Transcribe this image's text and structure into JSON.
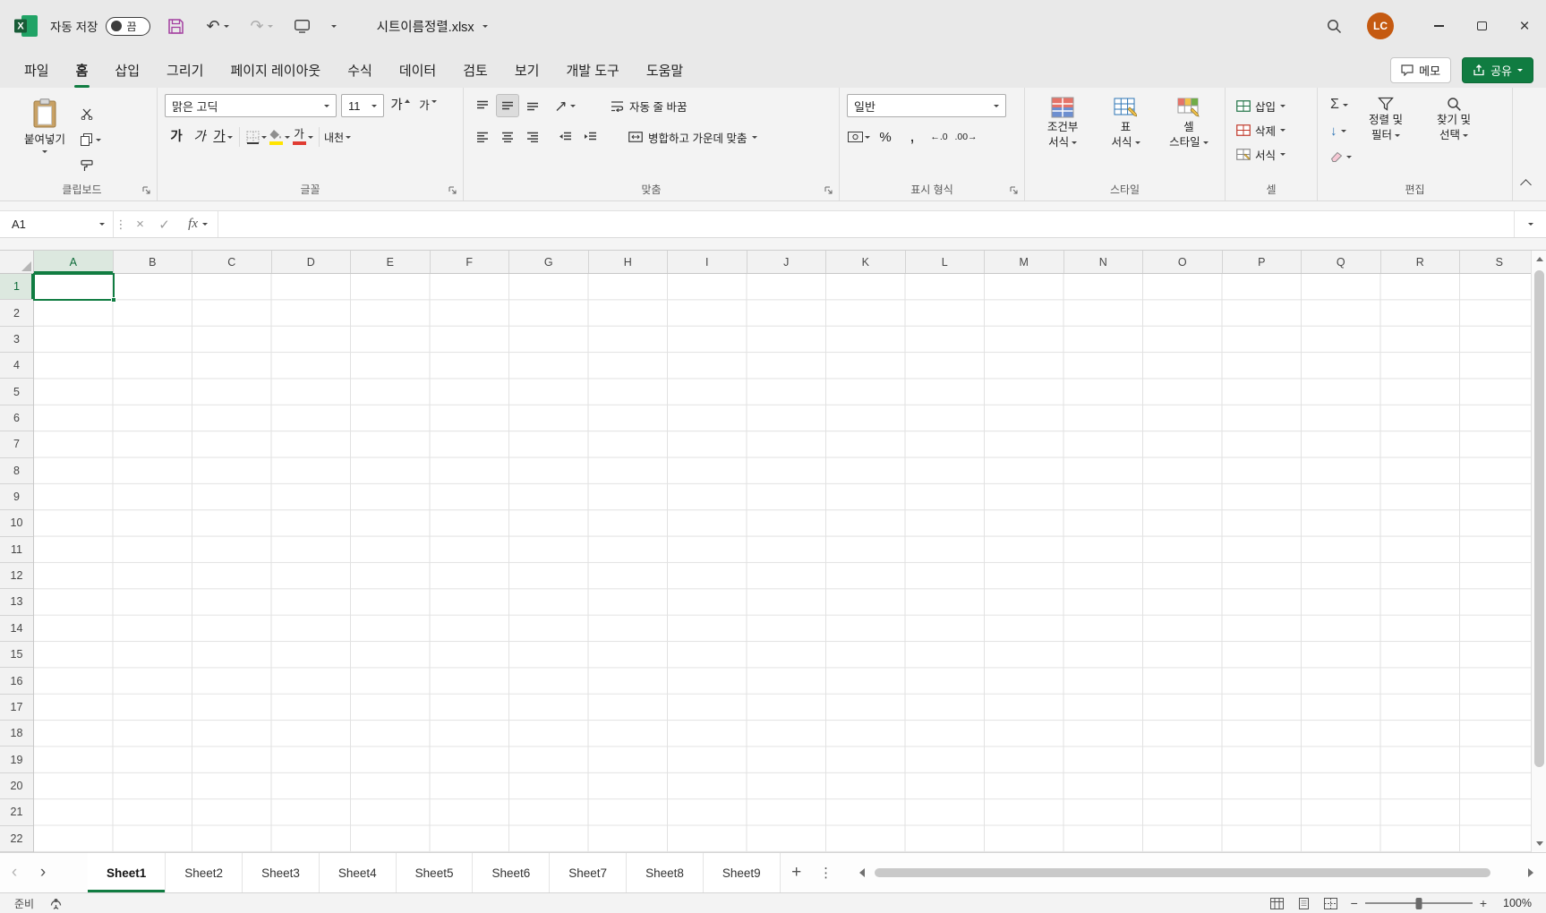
{
  "icons": {
    "undo": "↶",
    "redo": "↷",
    "autosum": "Σ",
    "fill_down": "↓",
    "percent": "%",
    "comma": ",",
    "increase_decimal": "←.0",
    "decrease_decimal": ".00→",
    "cancel": "×",
    "check": "✓",
    "more_vertical": "⋮",
    "nav_left": "‹",
    "nav_right": "›",
    "add_sheet": "+",
    "close": "×",
    "zoom_out": "−",
    "zoom_in": "+"
  },
  "titlebar": {
    "autosave_label": "자동 저장",
    "autosave_state": "끔",
    "filename": "시트이름정렬.xlsx",
    "avatar_initials": "LC"
  },
  "ribbon_tabs": {
    "items": [
      {
        "label": "파일",
        "active": false
      },
      {
        "label": "홈",
        "active": true
      },
      {
        "label": "삽입",
        "active": false
      },
      {
        "label": "그리기",
        "active": false
      },
      {
        "label": "페이지 레이아웃",
        "active": false
      },
      {
        "label": "수식",
        "active": false
      },
      {
        "label": "데이터",
        "active": false
      },
      {
        "label": "검토",
        "active": false
      },
      {
        "label": "보기",
        "active": false
      },
      {
        "label": "개발 도구",
        "active": false
      },
      {
        "label": "도움말",
        "active": false
      }
    ],
    "comments_label": "메모",
    "share_label": "공유"
  },
  "ribbon": {
    "clipboard": {
      "group_label": "클립보드",
      "paste_label": "붙여넣기"
    },
    "font": {
      "group_label": "글꼴",
      "font_name": "맑은 고딕",
      "font_size": "11",
      "grow_font_label": "가",
      "shrink_font_label": "가",
      "bold_label": "가",
      "italic_label": "가",
      "underline_label": "가",
      "color_label": "가",
      "phonetic_label": "내천",
      "highlight_color": "#FFE400",
      "font_color": "#E03C32"
    },
    "alignment": {
      "group_label": "맞춤",
      "wrap_label": "자동 줄 바꿈",
      "merge_label": "병합하고 가운데 맞춤"
    },
    "number": {
      "group_label": "표시 형식",
      "format_value": "일반"
    },
    "styles": {
      "group_label": "스타일",
      "buttons": [
        {
          "line1": "조건부",
          "line2": "서식"
        },
        {
          "line1": "표",
          "line2": "서식"
        },
        {
          "line1": "셀",
          "line2": "스타일"
        }
      ]
    },
    "cells": {
      "group_label": "셀",
      "insert_label": "삽입",
      "delete_label": "삭제",
      "format_label": "서식"
    },
    "editing": {
      "group_label": "편집",
      "sort_filter": {
        "line1": "정렬 및",
        "line2": "필터"
      },
      "find_select": {
        "line1": "찾기 및",
        "line2": "선택"
      }
    },
    "accent_green": "#107C41"
  },
  "formula_bar": {
    "name_box": "A1",
    "fx_label": "fx",
    "formula_value": ""
  },
  "grid": {
    "columns": [
      "A",
      "B",
      "C",
      "D",
      "E",
      "F",
      "G",
      "H",
      "I",
      "J",
      "K",
      "L",
      "M",
      "N",
      "O",
      "P",
      "Q",
      "R",
      "S"
    ],
    "row_count": 22,
    "selected_column": "A",
    "selected_row": 1,
    "selected_cell": "A1"
  },
  "sheets": {
    "tabs": [
      {
        "label": "Sheet1",
        "active": true
      },
      {
        "label": "Sheet2",
        "active": false
      },
      {
        "label": "Sheet3",
        "active": false
      },
      {
        "label": "Sheet4",
        "active": false
      },
      {
        "label": "Sheet5",
        "active": false
      },
      {
        "label": "Sheet6",
        "active": false
      },
      {
        "label": "Sheet7",
        "active": false
      },
      {
        "label": "Sheet8",
        "active": false
      },
      {
        "label": "Sheet9",
        "active": false
      }
    ]
  },
  "status": {
    "ready_label": "준비",
    "zoom_level": "100%"
  }
}
